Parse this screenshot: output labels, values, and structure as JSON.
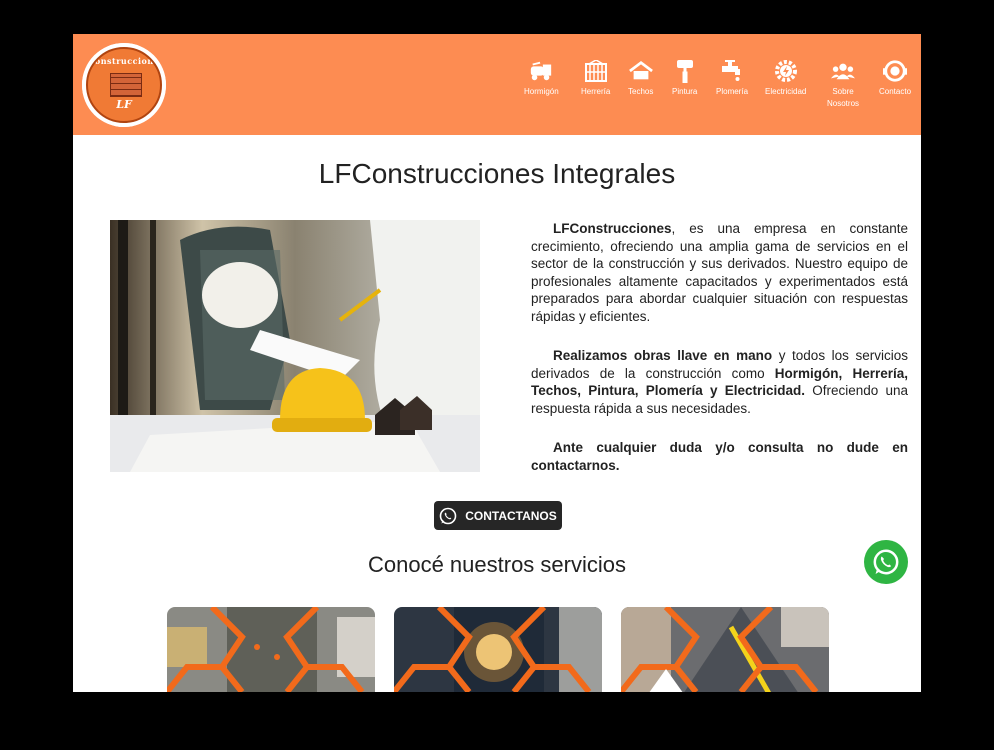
{
  "brand": {
    "logo_top": "Construcciones",
    "logo_bottom": "LF"
  },
  "nav": [
    {
      "label": "Hormigón",
      "icon": "concrete-mixer-icon"
    },
    {
      "label": "Herrería",
      "icon": "gate-icon"
    },
    {
      "label": "Techos",
      "icon": "roof-icon"
    },
    {
      "label": "Pintura",
      "icon": "paint-roller-icon"
    },
    {
      "label": "Plomería",
      "icon": "faucet-icon"
    },
    {
      "label": "Electricidad",
      "icon": "gear-electric-icon"
    },
    {
      "label": "Sobre\nNosotros",
      "icon": "users-icon"
    },
    {
      "label": "Contacto",
      "icon": "support-icon"
    }
  ],
  "page": {
    "title": "LFConstrucciones Integrales",
    "p1_bold": "LFConstrucciones",
    "p1_rest": ", es una empresa en constante crecimiento, ofreciendo una amplia gama de servicios en el sector de la construcción y sus derivados. Nuestro equipo de profesionales altamente capacitados y experimentados está preparados para abordar cualquier situación con respuestas rápidas y eficientes.",
    "p2_bold1": "Realizamos obras llave en mano",
    "p2_mid": " y todos los servicios derivados de la construcción como ",
    "p2_bold2": "Hormigón, Herrería, Techos, Pintura, Plomería y Electricidad.",
    "p2_end": " Ofreciendo una respuesta rápida a sus necesidades.",
    "p3": "Ante cualquier duda y/o consulta no dude en contactarnos.",
    "cta_label": "CONTACTANOS",
    "services_title": "Conocé nuestros servicios"
  },
  "colors": {
    "header": "#fd8c52",
    "button": "#262626",
    "whatsapp": "#2fb543",
    "hex_frame": "#f26a1b"
  }
}
